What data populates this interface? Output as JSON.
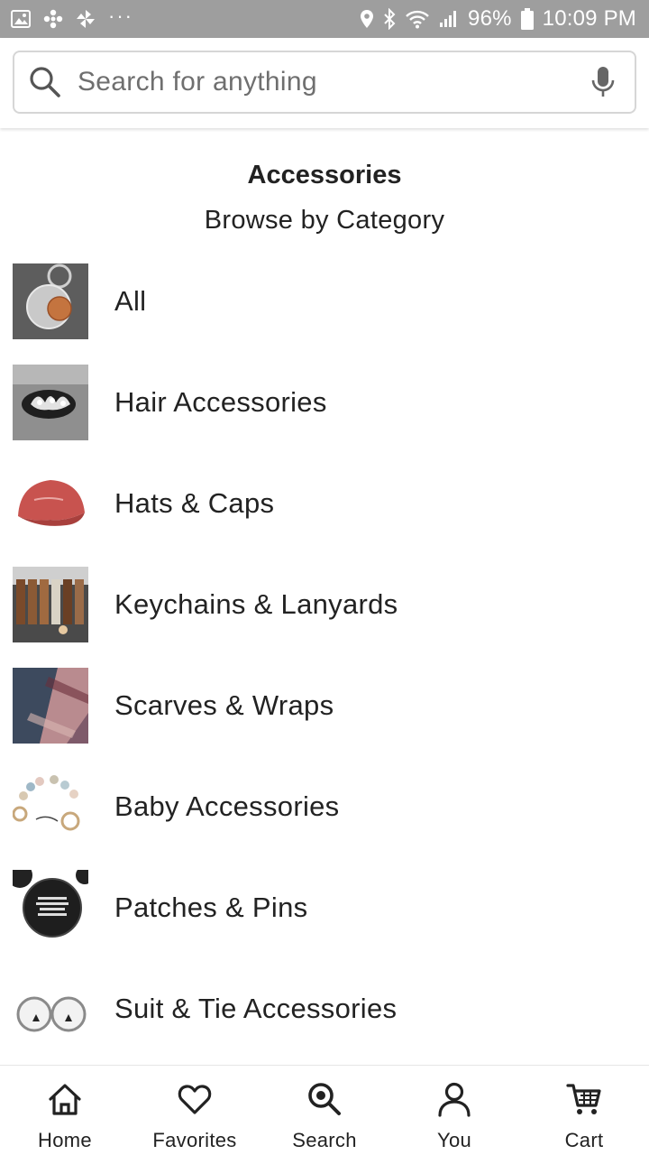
{
  "status_bar": {
    "battery": "96%",
    "time": "10:09 PM",
    "dots": "···"
  },
  "search": {
    "placeholder": "Search for anything"
  },
  "page": {
    "title": "Accessories",
    "subtitle": "Browse by Category"
  },
  "categories": [
    {
      "label": "All",
      "thumb": "keychain-coin"
    },
    {
      "label": "Hair Accessories",
      "thumb": "hair-clip"
    },
    {
      "label": "Hats & Caps",
      "thumb": "red-cap"
    },
    {
      "label": "Keychains & Lanyards",
      "thumb": "leather-keychains"
    },
    {
      "label": "Scarves & Wraps",
      "thumb": "plaid-scarf"
    },
    {
      "label": "Baby Accessories",
      "thumb": "teething-beads"
    },
    {
      "label": "Patches & Pins",
      "thumb": "black-pin"
    },
    {
      "label": "Suit & Tie Accessories",
      "thumb": "cufflinks"
    }
  ],
  "bottom_nav": [
    {
      "label": "Home",
      "icon": "home-icon"
    },
    {
      "label": "Favorites",
      "icon": "heart-icon"
    },
    {
      "label": "Search",
      "icon": "search-icon"
    },
    {
      "label": "You",
      "icon": "person-icon"
    },
    {
      "label": "Cart",
      "icon": "cart-icon"
    }
  ],
  "colors": {
    "status_bar": "#9e9e9e",
    "text": "#222222",
    "placeholder": "#6f6f6f"
  }
}
